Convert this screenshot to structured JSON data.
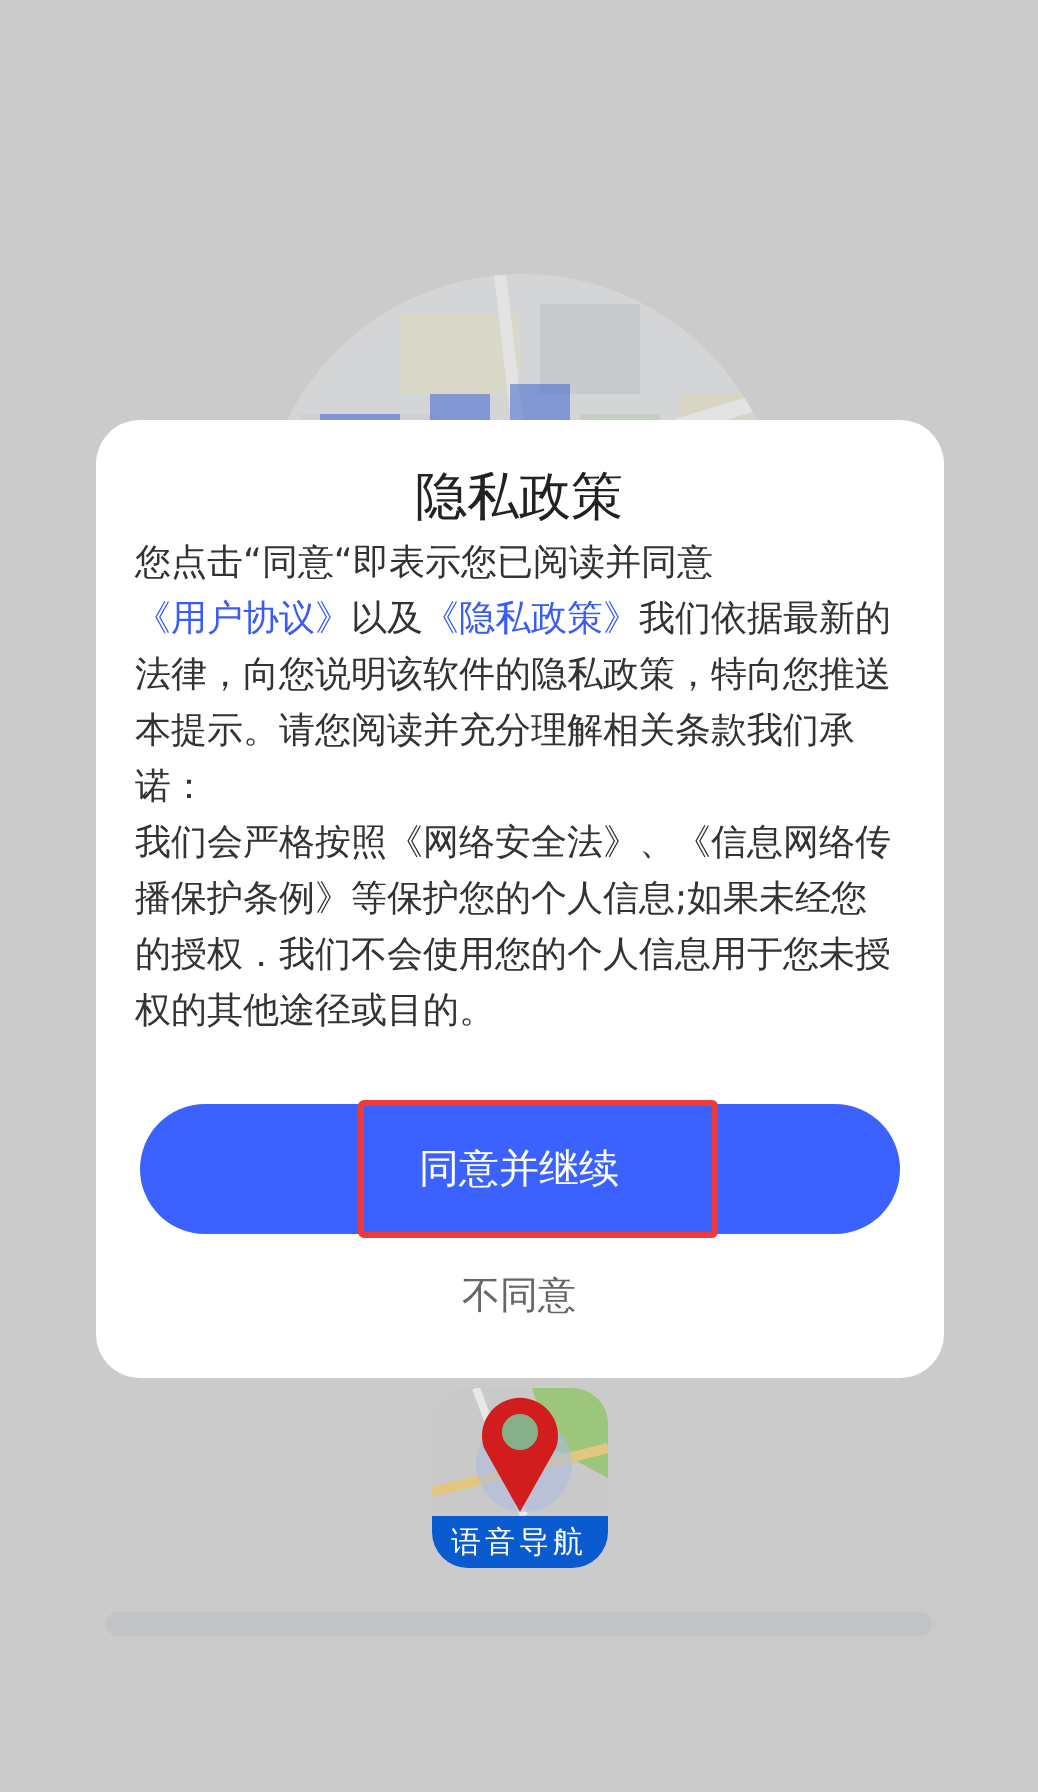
{
  "dialog": {
    "title": "隐私政策",
    "paragraphs": [
      [
        {
          "kind": "text",
          "text": "您点击“同意“即表示您已阅读并同意"
        },
        {
          "kind": "link",
          "text": "《用户协议》"
        },
        {
          "kind": "text",
          "text": "以及"
        },
        {
          "kind": "link",
          "text": "《隐私政策》"
        },
        {
          "kind": "text",
          "text": "我们依据最新的法律，向您说明该软件的隐私政策，特向您推送本提示。请您阅读并充分理解相关条款我们承诺："
        }
      ],
      [
        {
          "kind": "text",
          "text": "我们会严格按照《网络安全法》、《信息网络传播保护条例》等保护您的个人信息;如果未经您的授权．我们不会使用您的个人信息用于您未授权的其他途径或目的。"
        }
      ]
    ],
    "agree_button": {
      "label": "同意并继续",
      "highlighted": true
    },
    "decline_button": {
      "label": "不同意"
    }
  },
  "app_logo": {
    "label": "语音导航"
  }
}
